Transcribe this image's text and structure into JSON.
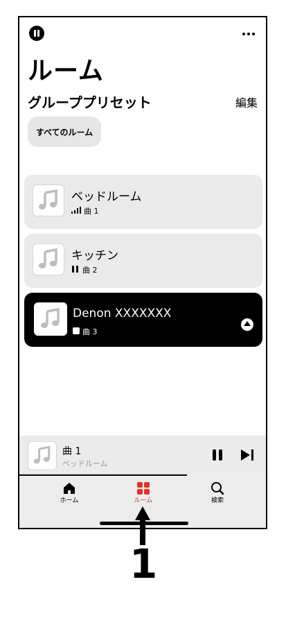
{
  "header": {
    "title": "ルーム"
  },
  "presets": {
    "title": "グループプリセット",
    "edit_label": "編集",
    "chip_label": "すべてのルーム"
  },
  "rooms": [
    {
      "name": "ベッドルーム",
      "status_icon": "signal-bars-icon",
      "track": "曲 1"
    },
    {
      "name": "キッチン",
      "status_icon": "pause-icon",
      "track": "曲 2"
    },
    {
      "name": "Denon XXXXXXX",
      "status_icon": "stop-icon",
      "track": "曲 3",
      "selected": true
    }
  ],
  "mini_player": {
    "track": "曲 1",
    "room": "ベッドルーム",
    "progress": 0.68
  },
  "tabs": [
    {
      "label": "ホーム",
      "icon": "home-icon"
    },
    {
      "label": "ルーム",
      "icon": "rooms-grid-icon",
      "active": true
    },
    {
      "label": "検索",
      "icon": "search-icon"
    }
  ],
  "callout": {
    "number": "1"
  },
  "colors": {
    "accent": "#e0342a",
    "card": "#eaeaea",
    "active_card": "#000000"
  }
}
